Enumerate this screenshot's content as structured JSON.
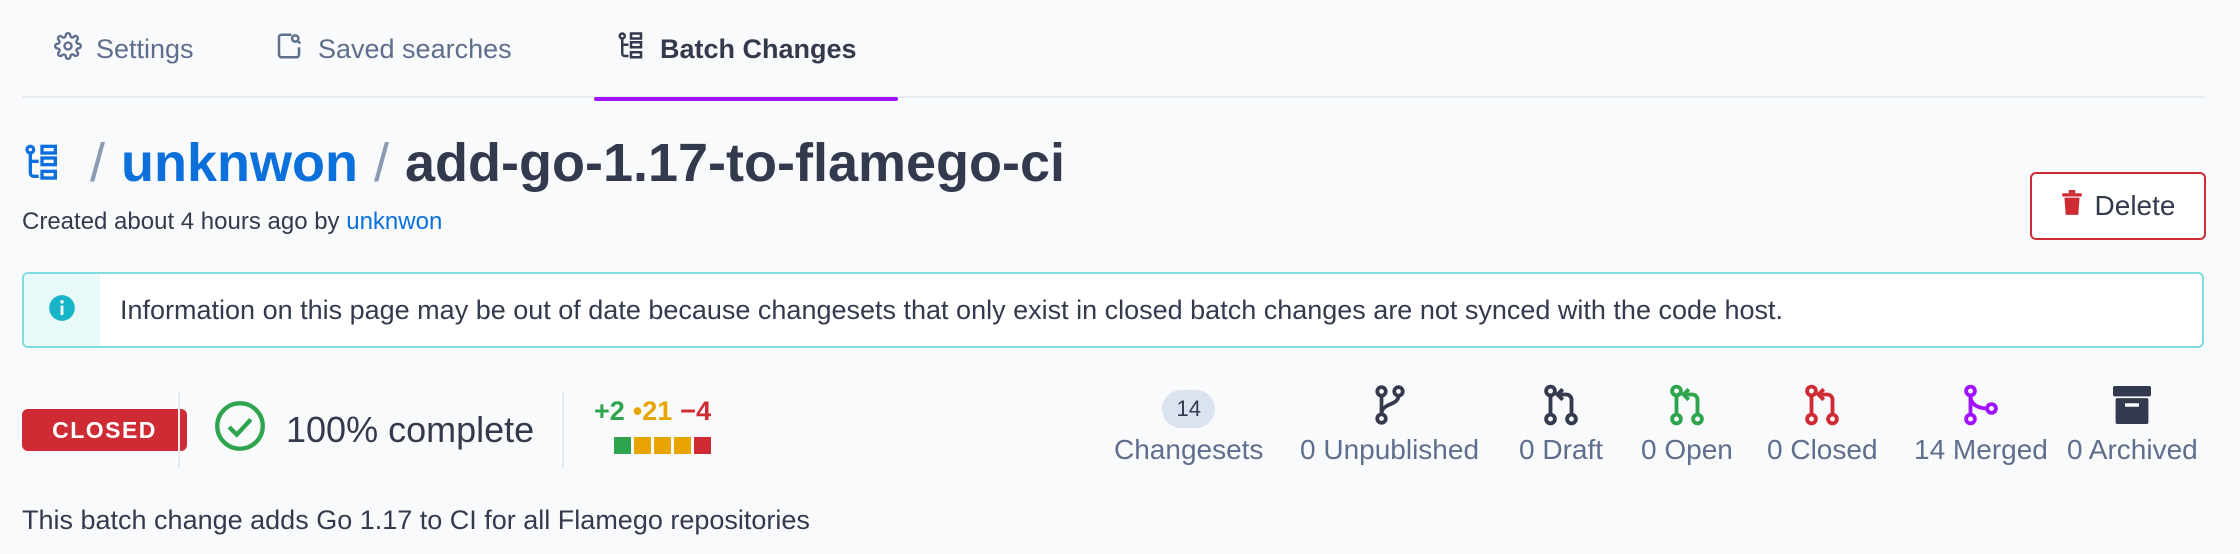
{
  "tabs": [
    {
      "label": "Settings",
      "icon": "gear-icon",
      "active": false
    },
    {
      "label": "Saved searches",
      "icon": "saved-search-icon",
      "active": false
    },
    {
      "label": "Batch Changes",
      "icon": "batch-changes-icon",
      "active": true
    }
  ],
  "header": {
    "separator": "/",
    "namespace": "unknwon",
    "name": "add-go-1.17-to-flamego-ci",
    "created_prefix": "Created about 4 hours ago by",
    "created_by": "unknwon"
  },
  "delete_button": {
    "label": "Delete"
  },
  "alert": {
    "text": "Information on this page may be out of date because changesets that only exist in closed batch changes are not synced with the code host."
  },
  "status": {
    "badge": "CLOSED",
    "complete": "100% complete",
    "diff": {
      "added": "+2",
      "changed": "•21",
      "deleted": "−4"
    }
  },
  "stats": {
    "changesets": {
      "count": "14",
      "label": "Changesets"
    },
    "unpublished": "0 Unpublished",
    "draft": "0 Draft",
    "open": "0 Open",
    "closed": "0 Closed",
    "merged": "14 Merged",
    "archived": "0 Archived"
  },
  "colors": {
    "accent": "#a112ff",
    "link": "#0b70db",
    "danger": "#cf2b35",
    "success": "#2ea44f",
    "warning": "#e8a400",
    "merged": "#a112ff",
    "info": "#18b4c7"
  },
  "description": "This batch change adds Go 1.17 to CI for all Flamego repositories"
}
